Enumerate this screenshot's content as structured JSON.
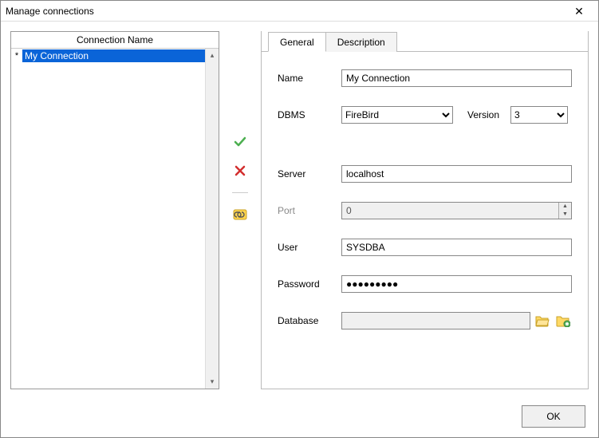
{
  "window": {
    "title": "Manage connections",
    "ok_label": "OK"
  },
  "list": {
    "header": "Connection Name",
    "items": [
      {
        "marker": "*",
        "name": "My Connection",
        "selected": true
      }
    ]
  },
  "toolbar": {
    "approve_icon": "check",
    "delete_icon": "cross",
    "link_icon": "link"
  },
  "tabs": {
    "general": "General",
    "description": "Description",
    "active": "general"
  },
  "form": {
    "name_label": "Name",
    "name_value": "My Connection",
    "dbms_label": "DBMS",
    "dbms_value": "FireBird",
    "version_label": "Version",
    "version_value": "3",
    "server_label": "Server",
    "server_value": "localhost",
    "port_label": "Port",
    "port_value": "0",
    "user_label": "User",
    "user_value": "SYSDBA",
    "password_label": "Password",
    "password_value": "●●●●●●●●●",
    "database_label": "Database",
    "database_value": ""
  }
}
